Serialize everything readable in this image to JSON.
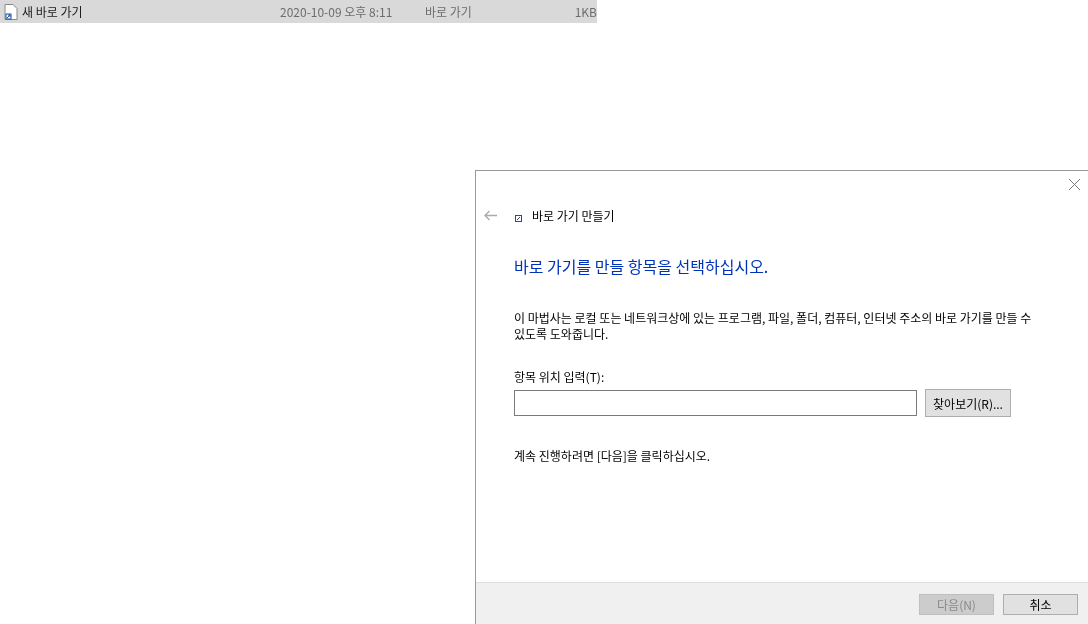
{
  "file_row": {
    "name": "새 바로 가기",
    "date": "2020-10-09 오후 8:11",
    "type": "바로 가기",
    "size": "1KB",
    "selected": true
  },
  "dialog": {
    "title": "바로 가기 만들기",
    "heading": "바로 가기를 만들 항목을 선택하십시오.",
    "description": "이 마법사는 로컬 또는 네트워크상에 있는 프로그램, 파일, 폴더, 컴퓨터, 인터넷 주소의 바로 가기를 만들 수 있도록 도와줍니다.",
    "field_label": "항목 위치 입력(T):",
    "browse_button": "찾아보기(R)...",
    "instruction": "계속 진행하려면 [다음]을 클릭하십시오.",
    "buttons": [
      {
        "label": "다음(N)",
        "disabled": true
      },
      {
        "label": "취소",
        "disabled": false
      }
    ]
  }
}
